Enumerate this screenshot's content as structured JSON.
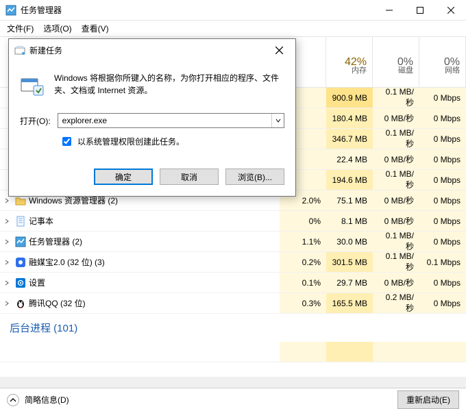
{
  "window": {
    "title": "任务管理器",
    "menu": {
      "file": "文件(F)",
      "options": "选项(O)",
      "view": "查看(V)"
    }
  },
  "headers": {
    "mem_pct": "42%",
    "mem_lbl": "内存",
    "disk_pct": "0%",
    "disk_lbl": "磁盘",
    "net_pct": "0%",
    "net_lbl": "网络"
  },
  "rows": [
    {
      "name": "",
      "cpu": "",
      "mem": "900.9 MB",
      "disk": "0.1 MB/秒",
      "net": "0 Mbps",
      "memHeat": 2
    },
    {
      "name": "",
      "cpu": "",
      "mem": "180.4 MB",
      "disk": "0 MB/秒",
      "net": "0 Mbps",
      "memHeat": 1
    },
    {
      "name": "",
      "cpu": "",
      "mem": "346.7 MB",
      "disk": "0.1 MB/秒",
      "net": "0 Mbps",
      "memHeat": 1
    },
    {
      "name": "",
      "cpu": "",
      "mem": "22.4 MB",
      "disk": "0 MB/秒",
      "net": "0 Mbps",
      "memHeat": 0
    },
    {
      "name": "",
      "cpu": "",
      "mem": "194.6 MB",
      "disk": "0.1 MB/秒",
      "net": "0 Mbps",
      "memHeat": 1
    },
    {
      "name": "Windows 资源管理器 (2)",
      "cpu": "2.0%",
      "mem": "75.1 MB",
      "disk": "0 MB/秒",
      "net": "0 Mbps",
      "memHeat": 0,
      "exp": true,
      "icon": "folder"
    },
    {
      "name": "记事本",
      "cpu": "0%",
      "mem": "8.1 MB",
      "disk": "0 MB/秒",
      "net": "0 Mbps",
      "memHeat": 0,
      "exp": false,
      "icon": "notepad"
    },
    {
      "name": "任务管理器 (2)",
      "cpu": "1.1%",
      "mem": "30.0 MB",
      "disk": "0.1 MB/秒",
      "net": "0 Mbps",
      "memHeat": 0,
      "exp": true,
      "icon": "taskmgr"
    },
    {
      "name": "融媒宝2.0 (32 位) (3)",
      "cpu": "0.2%",
      "mem": "301.5 MB",
      "disk": "0.1 MB/秒",
      "net": "0.1 Mbps",
      "memHeat": 1,
      "exp": true,
      "icon": "blue"
    },
    {
      "name": "设置",
      "cpu": "0.1%",
      "mem": "29.7 MB",
      "disk": "0 MB/秒",
      "net": "0 Mbps",
      "memHeat": 0,
      "exp": false,
      "icon": "gear"
    },
    {
      "name": "腾讯QQ (32 位)",
      "cpu": "0.3%",
      "mem": "165.5 MB",
      "disk": "0.2 MB/秒",
      "net": "0 Mbps",
      "memHeat": 1,
      "exp": true,
      "icon": "qq"
    }
  ],
  "section": {
    "bg_title": "后台进程 (101)"
  },
  "footer": {
    "fewer": "简略信息(D)",
    "restart": "重新启动(E)"
  },
  "dialog": {
    "title": "新建任务",
    "description": "Windows 将根据你所键入的名称，为你打开相应的程序、文件夹、文档或 Internet 资源。",
    "open_label": "打开(O):",
    "input_value": "explorer.exe",
    "admin_check": "以系统管理权限创建此任务。",
    "ok": "确定",
    "cancel": "取消",
    "browse": "浏览(B)..."
  }
}
